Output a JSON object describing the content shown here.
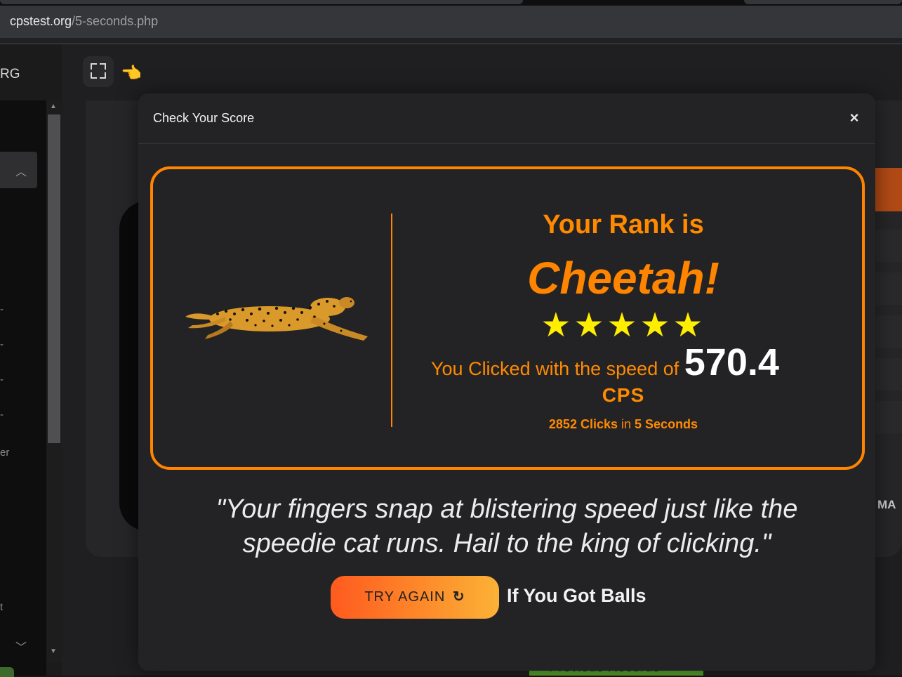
{
  "browser": {
    "url_host": "cpstest.org",
    "url_path": "/5-seconds.php"
  },
  "page": {
    "brand_fragment": "RG",
    "sidebar_fragments": [
      "er",
      "t"
    ],
    "right_fragment": "MA",
    "records_button": "Previous Records"
  },
  "modal": {
    "title": "Check Your Score",
    "close_label": "×",
    "rank_label": "Your Rank is",
    "rank_name": "Cheetah!",
    "stars": "★★★★★",
    "star_rating": 5,
    "speed_prefix": "You Clicked with the speed of",
    "speed_value": "570.4",
    "speed_unit": "CPS",
    "clicks_count": "2852 Clicks",
    "clicks_in": "in",
    "duration": "5 Seconds",
    "quote": "\"Your fingers snap at blistering speed just like the speedie cat runs. Hail to the king of clicking.\"",
    "try_again_label": "TRY AGAIN",
    "try_again_icon": "↻",
    "challenge_text": "If You Got Balls"
  },
  "colors": {
    "accent": "#ff8400",
    "stars": "#ffee00",
    "modal_bg": "#232325",
    "button_gradient_start": "#ff5a1f",
    "button_gradient_end": "#fbb237"
  },
  "icons": {
    "fullscreen": "fullscreen-icon",
    "pointing_hand": "pointing-hand-icon",
    "close": "close-icon",
    "refresh": "refresh-icon",
    "cheetah": "cheetah-image"
  }
}
